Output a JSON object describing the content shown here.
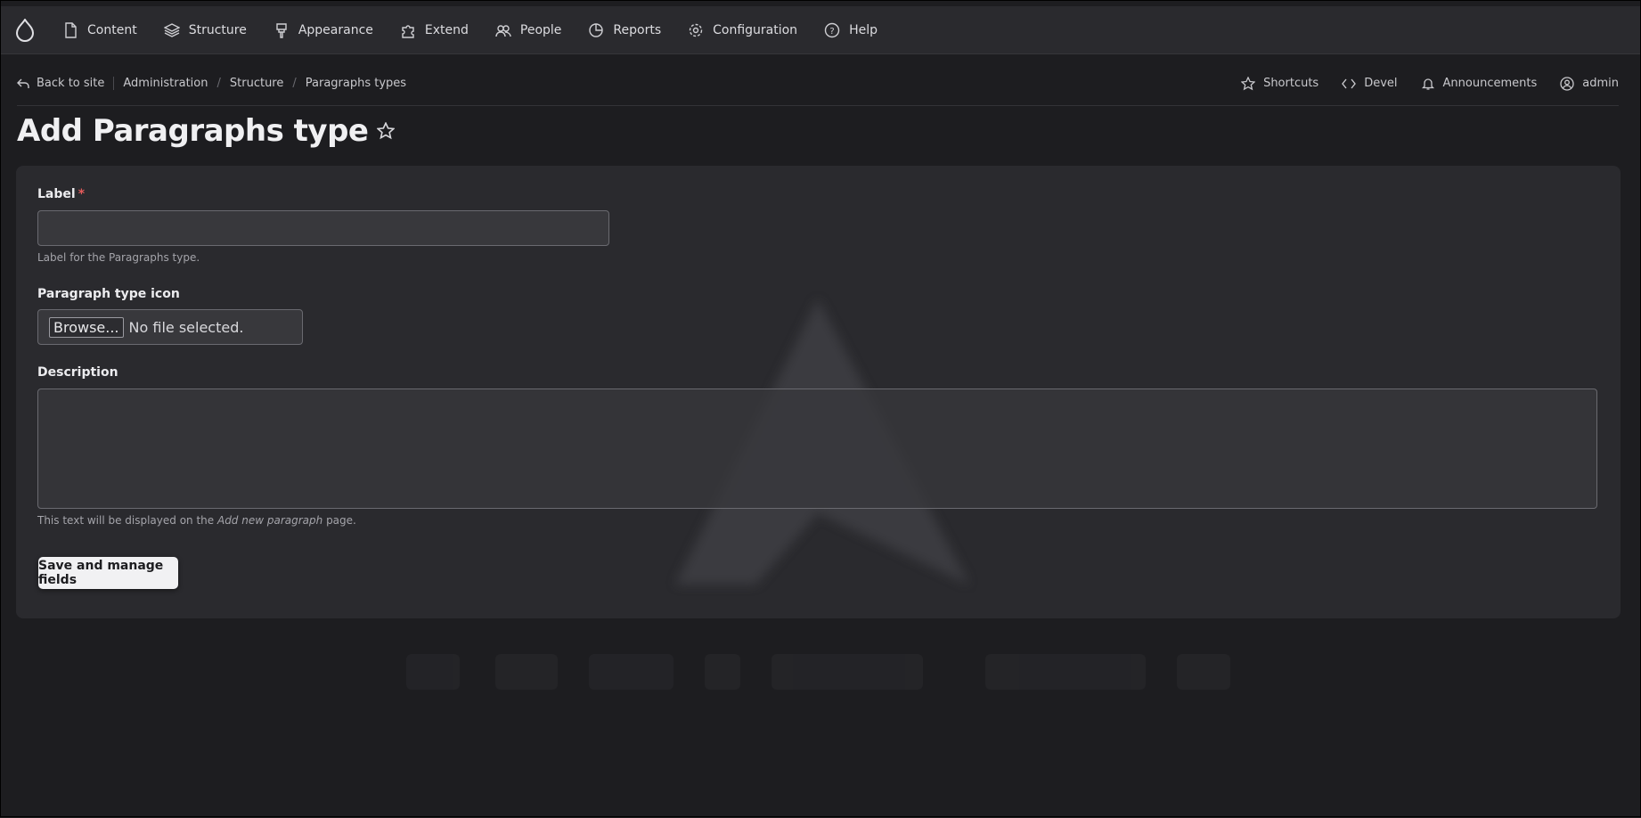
{
  "nav": [
    {
      "label": "Content",
      "icon": "content-icon"
    },
    {
      "label": "Structure",
      "icon": "structure-icon"
    },
    {
      "label": "Appearance",
      "icon": "appearance-icon"
    },
    {
      "label": "Extend",
      "icon": "extend-icon"
    },
    {
      "label": "People",
      "icon": "people-icon"
    },
    {
      "label": "Reports",
      "icon": "reports-icon"
    },
    {
      "label": "Configuration",
      "icon": "configuration-icon"
    },
    {
      "label": "Help",
      "icon": "help-icon"
    }
  ],
  "breadcrumb": {
    "back": "Back to site",
    "items": [
      "Administration",
      "Structure",
      "Paragraphs types"
    ]
  },
  "tools": {
    "shortcuts": "Shortcuts",
    "devel": "Devel",
    "announcements": "Announcements",
    "user": "admin"
  },
  "page": {
    "title": "Add Paragraphs type"
  },
  "form": {
    "label": {
      "title": "Label",
      "required": "*",
      "value": "",
      "help": "Label for the Paragraphs type."
    },
    "icon": {
      "title": "Paragraph type icon",
      "browse": "Browse...",
      "status": "No file selected."
    },
    "description": {
      "title": "Description",
      "value": "",
      "help_before": "This text will be displayed on the ",
      "help_em": "Add new paragraph",
      "help_after": " page."
    },
    "submit": "Save and manage fields"
  },
  "colors": {
    "background": "#1d1d20",
    "card": "#2a2a2e",
    "required": "#e35b5b"
  }
}
